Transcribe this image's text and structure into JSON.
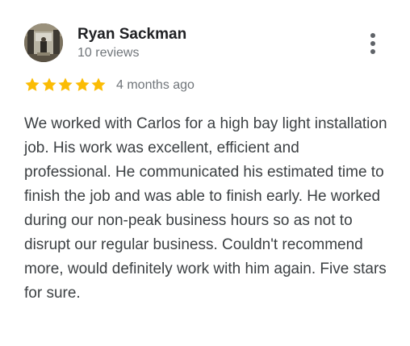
{
  "review": {
    "reviewer_name": "Ryan Sackman",
    "review_count": "10 reviews",
    "rating": 5,
    "rating_max": 5,
    "date": "4 months ago",
    "text": "We worked with Carlos for a high bay light installation job. His work was excellent, efficient and professional. He communicated his estimated time to finish the job and was able to finish early. He worked during our non-peak business hours so as not to disrupt our regular business. Couldn't recommend more, would definitely work with him again. Five stars for sure.",
    "more_icon": "more-vert-icon",
    "star_icon": "star-icon"
  },
  "colors": {
    "star": "#fbbc04",
    "name": "#202124",
    "meta": "#70757a",
    "body_text": "#3c4043",
    "icon": "#5f6368"
  }
}
